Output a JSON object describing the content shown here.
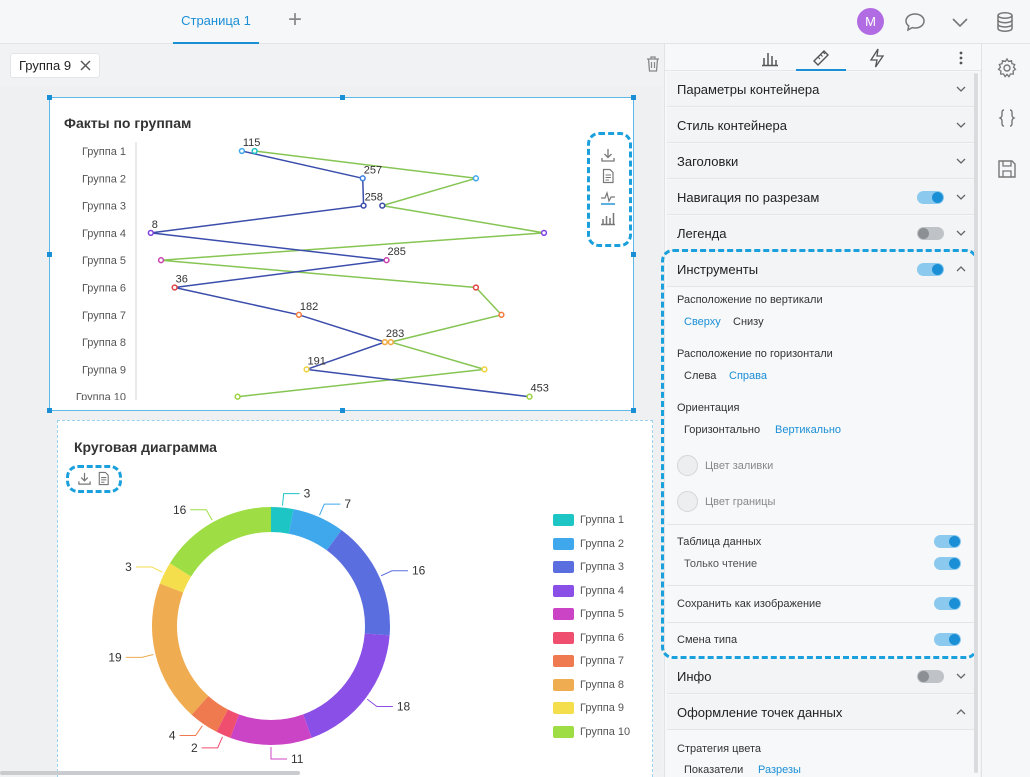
{
  "topbar": {
    "page_tab": "Страница 1",
    "add_tab": "+",
    "avatar_letter": "M"
  },
  "group_chip": {
    "label": "Группа 9"
  },
  "widget1": {
    "title": "Факты по группам",
    "chart_data": {
      "type": "line",
      "orientation": "horizontal",
      "categories": [
        "Группа 1",
        "Группа 2",
        "Группа 3",
        "Группа 4",
        "Группа 5",
        "Группа 6",
        "Группа 7",
        "Группа  8",
        "Группа 9",
        "Группа 10"
      ],
      "series": [
        {
          "color": "#3b4dab",
          "values": [
            115,
            257,
            258,
            8,
            285,
            36,
            182,
            283,
            191,
            453
          ],
          "point_colors": [
            "#3fa8ec",
            "#3b7fe0",
            "#3b4dab",
            "#7e3fe0",
            "#c93fae",
            "#e04444",
            "#f07a3c",
            "#f0a83c",
            "#f0d23c",
            "#9ad23c"
          ]
        },
        {
          "color": "#86c553",
          "values": [
            130,
            390,
            280,
            470,
            20,
            390,
            420,
            290,
            400,
            110
          ],
          "point_colors": [
            "#1ec5c5",
            "#3fa8ec",
            "#3b4dab",
            "#7e3fe0",
            "#c93fae",
            "#e04444",
            "#f07a3c",
            "#f0a83c",
            "#f0d23c",
            "#9ad23c"
          ]
        }
      ],
      "data_labels": [
        "115",
        "257",
        "258",
        "8",
        "285",
        "36",
        "182",
        "283",
        "191",
        "453"
      ]
    }
  },
  "widget2": {
    "title": "Круговая диаграмма",
    "chart_data": {
      "type": "pie",
      "variant": "donut",
      "categories": [
        "Группа 1",
        "Группа 2",
        "Группа 3",
        "Группа 4",
        "Группа 5",
        "Группа 6",
        "Группа 7",
        "Группа  8",
        "Группа 9",
        "Группа  10"
      ],
      "values": [
        3,
        7,
        16,
        18,
        11,
        2,
        4,
        19,
        3,
        16
      ],
      "colors": [
        "#1ec5c5",
        "#3fa8ec",
        "#5b6ee0",
        "#8a4fe6",
        "#cc44c6",
        "#f04e6e",
        "#f07a50",
        "#f0ac50",
        "#f4de4c",
        "#9ede44"
      ],
      "legend_position": "right"
    }
  },
  "panel": {
    "sections": [
      {
        "label": "Параметры контейнера",
        "toggle": null,
        "expanded": false
      },
      {
        "label": "Стиль контейнера",
        "toggle": null,
        "expanded": false
      },
      {
        "label": "Заголовки",
        "toggle": null,
        "expanded": false
      },
      {
        "label": "Навигация по разрезам",
        "toggle": "on",
        "expanded": false
      },
      {
        "label": "Легенда",
        "toggle": "off",
        "expanded": false
      },
      {
        "label": "Инструменты",
        "toggle": "on",
        "expanded": true
      }
    ],
    "tools": {
      "vertical_label": "Расположение по вертикали",
      "vertical_options": [
        "Сверху",
        "Снизу"
      ],
      "horizontal_label": "Расположение по горизонтали",
      "horizontal_options": [
        "Слева",
        "Справа"
      ],
      "orientation_label": "Ориентация",
      "orientation_options": [
        "Горизонтально",
        "Вертикально"
      ],
      "fill_color": "Цвет заливки",
      "border_color": "Цвет границы",
      "data_table": "Таблица данных",
      "read_only": "Только чтение",
      "save_image": "Сохранить как изображение",
      "change_type": "Смена типа"
    },
    "info": "Инфо",
    "data_points": "Оформление точек данных",
    "color_strategy": "Стратегия цвета",
    "color_strategy_options": [
      "Показатели",
      "Разрезы"
    ]
  }
}
